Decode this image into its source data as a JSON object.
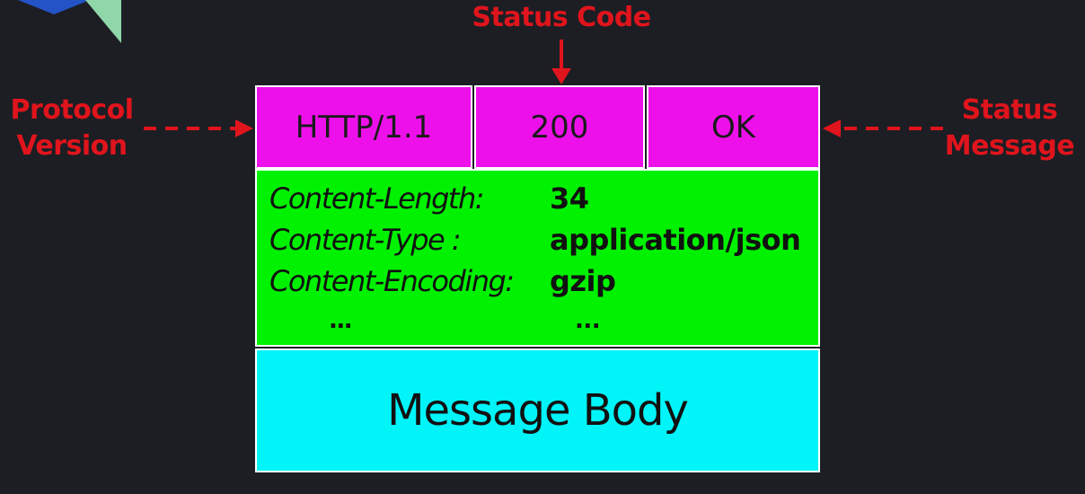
{
  "callouts": {
    "status_code": "Status Code",
    "protocol_version": "Protocol\nVersion",
    "status_message": "Status\nMessage"
  },
  "status_line": {
    "protocol": "HTTP/1.1",
    "code": "200",
    "message": "OK"
  },
  "headers": [
    {
      "name": "Content-Length:",
      "value": "34"
    },
    {
      "name": "Content-Type :",
      "value": "application/json"
    },
    {
      "name": "Content-Encoding:",
      "value": "gzip"
    },
    {
      "name": "...",
      "value": "..."
    }
  ],
  "body": {
    "label": "Message Body"
  },
  "colors": {
    "background": "#1c1e24",
    "callout": "#e0141c",
    "status_line": "#ee10ea",
    "headers": "#00f200",
    "body": "#00f4f8"
  }
}
